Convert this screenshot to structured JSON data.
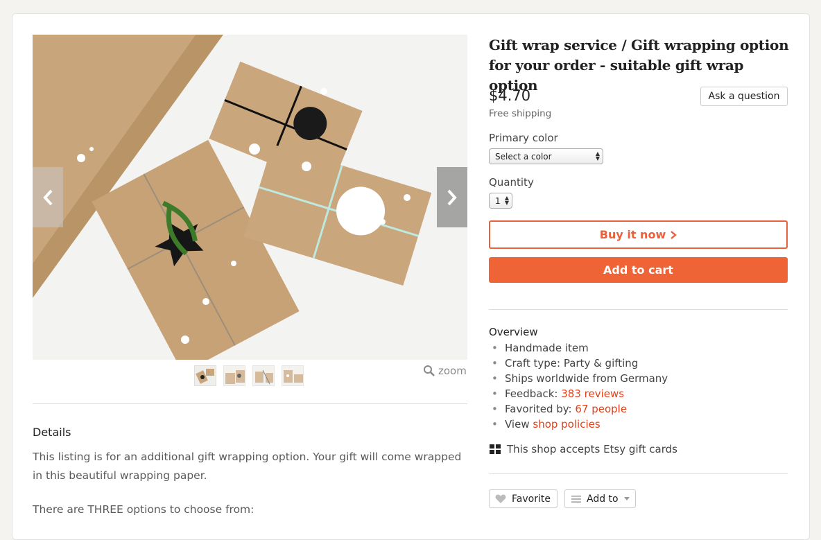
{
  "listing": {
    "title": "Gift wrap service / Gift wrapping option for your order - suitable gift wrap option",
    "price": "$4.70",
    "shipping": "Free shipping",
    "ask_label": "Ask a question"
  },
  "options": {
    "primary_color_label": "Primary color",
    "primary_color_value": "Select a color",
    "quantity_label": "Quantity",
    "quantity_value": "1"
  },
  "actions": {
    "buy_now": "Buy it now",
    "add_to_cart": "Add to cart",
    "favorite": "Favorite",
    "add_to": "Add to"
  },
  "gallery": {
    "zoom_label": "zoom",
    "thumbnail_count": 4
  },
  "details": {
    "title": "Details",
    "text": "This listing is for an additional gift wrapping option. Your gift will come wrapped in this beautiful wrapping paper.",
    "text2": "There are THREE options to choose from:"
  },
  "overview": {
    "title": "Overview",
    "item1": "Handmade item",
    "item2": "Craft type: Party & gifting",
    "item3": "Ships worldwide from Germany",
    "feedback_prefix": "Feedback: ",
    "feedback_link": "383 reviews",
    "favorited_prefix": "Favorited by: ",
    "favorited_link": "67 people",
    "view_prefix": "View ",
    "view_link": "shop policies"
  },
  "giftcards_text": "This shop accepts Etsy gift cards",
  "colors": {
    "accent": "#ee6437",
    "link": "#e0421b",
    "kraft": "#c9a57a"
  }
}
